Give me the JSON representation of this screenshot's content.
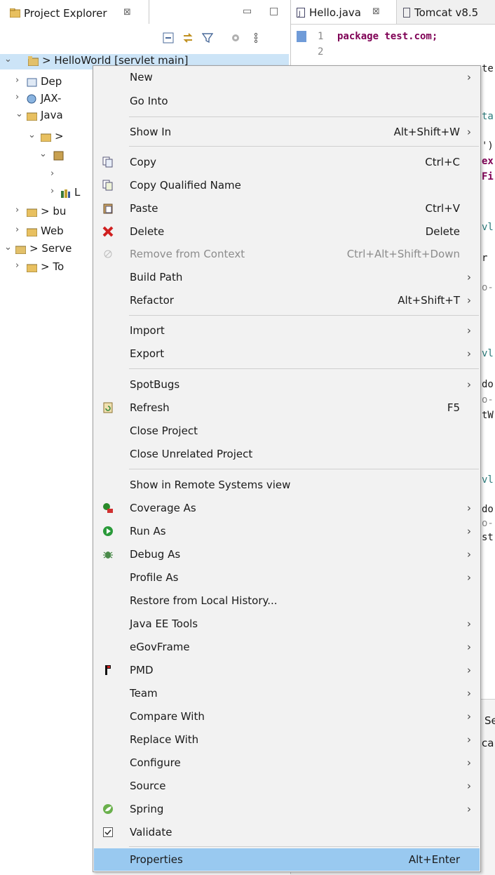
{
  "project_explorer": {
    "tab_title": "Project Explorer",
    "tab_close": "⊠",
    "tree": [
      {
        "label": "> HelloWorld [servlet main]"
      },
      {
        "label": "Dep"
      },
      {
        "label": "JAX-"
      },
      {
        "label": "Java"
      },
      {
        "label": ">"
      },
      {
        "label": ""
      },
      {
        "label": ""
      },
      {
        "label": "L"
      },
      {
        "label": "> bu"
      },
      {
        "label": "Web"
      },
      {
        "label": "> Serve"
      },
      {
        "label": "> To"
      }
    ]
  },
  "editor": {
    "tabs": [
      {
        "label": "Hello.java",
        "close": "⊠"
      },
      {
        "label": "Tomcat v8.5"
      }
    ],
    "line_numbers": [
      "1",
      "2"
    ],
    "code_line1": "package test.com;",
    "fragments": [
      "te",
      "ta",
      "')",
      "ex",
      "Fi",
      "vl",
      "r",
      "o-",
      "vl",
      "do",
      "o-",
      "tW",
      "vl",
      "do",
      "o-",
      "st",
      "Se",
      "ca"
    ]
  },
  "context_menu": {
    "items": [
      {
        "label": "New",
        "shortcut": "",
        "submenu": true,
        "icon": ""
      },
      {
        "label": "Go Into",
        "shortcut": "",
        "submenu": false,
        "icon": ""
      },
      {
        "label": "Show In",
        "shortcut": "Alt+Shift+W",
        "submenu": true,
        "icon": ""
      },
      {
        "label": "Copy",
        "shortcut": "Ctrl+C",
        "submenu": false,
        "icon": "copy-icon"
      },
      {
        "label": "Copy Qualified Name",
        "shortcut": "",
        "submenu": false,
        "icon": "copy-qualified-name-icon"
      },
      {
        "label": "Paste",
        "shortcut": "Ctrl+V",
        "submenu": false,
        "icon": "paste-icon"
      },
      {
        "label": "Delete",
        "shortcut": "Delete",
        "submenu": false,
        "icon": "delete-icon"
      },
      {
        "label": "Remove from Context",
        "shortcut": "Ctrl+Alt+Shift+Down",
        "submenu": false,
        "icon": "remove-context-icon",
        "disabled": true
      },
      {
        "label": "Build Path",
        "shortcut": "",
        "submenu": true,
        "icon": ""
      },
      {
        "label": "Refactor",
        "shortcut": "Alt+Shift+T",
        "submenu": true,
        "icon": ""
      },
      {
        "label": "Import",
        "shortcut": "",
        "submenu": true,
        "icon": ""
      },
      {
        "label": "Export",
        "shortcut": "",
        "submenu": true,
        "icon": ""
      },
      {
        "label": "SpotBugs",
        "shortcut": "",
        "submenu": true,
        "icon": ""
      },
      {
        "label": "Refresh",
        "shortcut": "F5",
        "submenu": false,
        "icon": "refresh-icon"
      },
      {
        "label": "Close Project",
        "shortcut": "",
        "submenu": false,
        "icon": ""
      },
      {
        "label": "Close Unrelated Project",
        "shortcut": "",
        "submenu": false,
        "icon": ""
      },
      {
        "label": "Show in Remote Systems view",
        "shortcut": "",
        "submenu": false,
        "icon": ""
      },
      {
        "label": "Coverage As",
        "shortcut": "",
        "submenu": true,
        "icon": "coverage-icon"
      },
      {
        "label": "Run As",
        "shortcut": "",
        "submenu": true,
        "icon": "run-icon"
      },
      {
        "label": "Debug As",
        "shortcut": "",
        "submenu": true,
        "icon": "debug-bug-icon"
      },
      {
        "label": "Profile As",
        "shortcut": "",
        "submenu": true,
        "icon": ""
      },
      {
        "label": "Restore from Local History...",
        "shortcut": "",
        "submenu": false,
        "icon": ""
      },
      {
        "label": "Java EE Tools",
        "shortcut": "",
        "submenu": true,
        "icon": ""
      },
      {
        "label": "eGovFrame",
        "shortcut": "",
        "submenu": true,
        "icon": ""
      },
      {
        "label": "PMD",
        "shortcut": "",
        "submenu": true,
        "icon": "pmd-icon"
      },
      {
        "label": "Team",
        "shortcut": "",
        "submenu": true,
        "icon": ""
      },
      {
        "label": "Compare With",
        "shortcut": "",
        "submenu": true,
        "icon": ""
      },
      {
        "label": "Replace With",
        "shortcut": "",
        "submenu": true,
        "icon": ""
      },
      {
        "label": "Configure",
        "shortcut": "",
        "submenu": true,
        "icon": ""
      },
      {
        "label": "Source",
        "shortcut": "",
        "submenu": true,
        "icon": ""
      },
      {
        "label": "Spring",
        "shortcut": "",
        "submenu": true,
        "icon": "spring-leaf-icon"
      },
      {
        "label": "Validate",
        "shortcut": "",
        "submenu": false,
        "icon": "validate-checkbox-icon"
      },
      {
        "label": "Properties",
        "shortcut": "Alt+Enter",
        "submenu": false,
        "icon": "",
        "selected": true
      }
    ],
    "submenu_arrow": "›"
  },
  "colors": {
    "menu_bg": "#f2f2f2",
    "selection": "#99c9f0",
    "keyword": "#7f0055",
    "tree_selection": "#cce4f7"
  }
}
